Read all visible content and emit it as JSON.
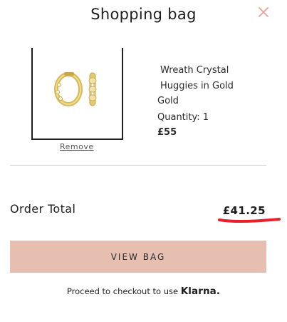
{
  "header": {
    "title": "Shopping bag",
    "close_icon": "close-icon"
  },
  "item": {
    "name_line1": "Wreath Crystal",
    "name_line2": "Huggies in Gold",
    "variant": "Gold",
    "quantity": "Quantity: 1",
    "price": "£55",
    "remove_label": "Remove",
    "image_icon": "gold-huggie-earrings-image"
  },
  "summary": {
    "total_label": "Order Total",
    "total_value": "£41.25"
  },
  "actions": {
    "view_bag_label": "VIEW BAG"
  },
  "checkout": {
    "text": "Proceed to checkout to use",
    "provider": "Klarna."
  },
  "colors": {
    "accent_button": "#e7bfb1",
    "close_icon": "#e9a196",
    "highlight": "#e8202a",
    "divider": "#e6d0c6"
  }
}
